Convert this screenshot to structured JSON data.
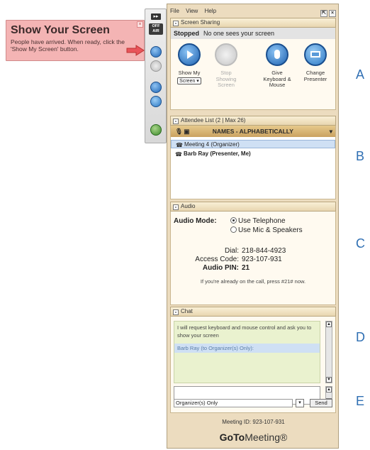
{
  "tooltip": {
    "title": "Show Your Screen",
    "text": "People have arrived. When ready, click the 'Show My Screen' button.",
    "close": "×"
  },
  "grab_tab": {
    "collapse": "▸▸",
    "off_label": "OFF AIR"
  },
  "menubar": {
    "items": [
      "File",
      "View",
      "Help"
    ]
  },
  "screen_sharing": {
    "header": "Screen Sharing",
    "status_label": "Stopped",
    "status_text": "No one sees your screen",
    "buttons": [
      {
        "label": "Show My",
        "sub": "Screen ▾"
      },
      {
        "label": "Stop Showing Screen"
      },
      {
        "label": "Give Keyboard & Mouse"
      },
      {
        "label": "Change Presenter"
      }
    ]
  },
  "attendee_list": {
    "header": "Attendee List  (2 | Max 26)",
    "sort_label": "NAMES - ALPHABETICALLY",
    "rows": [
      "Meeting 4 (Organizer)",
      "Barb Ray (Presenter, Me)"
    ]
  },
  "audio": {
    "header": "Audio",
    "mode_label": "Audio Mode:",
    "options": [
      "Use Telephone",
      "Use Mic & Speakers"
    ],
    "dial_label": "Dial:",
    "dial": "218-844-4923",
    "access_label": "Access Code:",
    "access_code": "923-107-931",
    "pin_label": "Audio PIN:",
    "pin": "21",
    "note": "If you're already on the call, press #21# now."
  },
  "chat": {
    "header": "Chat",
    "message": "I will request keyboard and mouse control and ask you to show your screen",
    "to_line": "Barb Ray (to Organizer(s) Only):",
    "recipient": "Organizer(s) Only",
    "send": "Send"
  },
  "footer": {
    "meeting_id": "Meeting ID: 923-107-931",
    "brand_goto": "GoTo",
    "brand_meeting": "Meeting®"
  },
  "side_labels": [
    "A",
    "B",
    "C",
    "D",
    "E"
  ],
  "colors": {
    "accent_blue": "#2f6fb3",
    "panel_bg": "#ecdcbf",
    "callout_bg": "#f4b4b4"
  }
}
